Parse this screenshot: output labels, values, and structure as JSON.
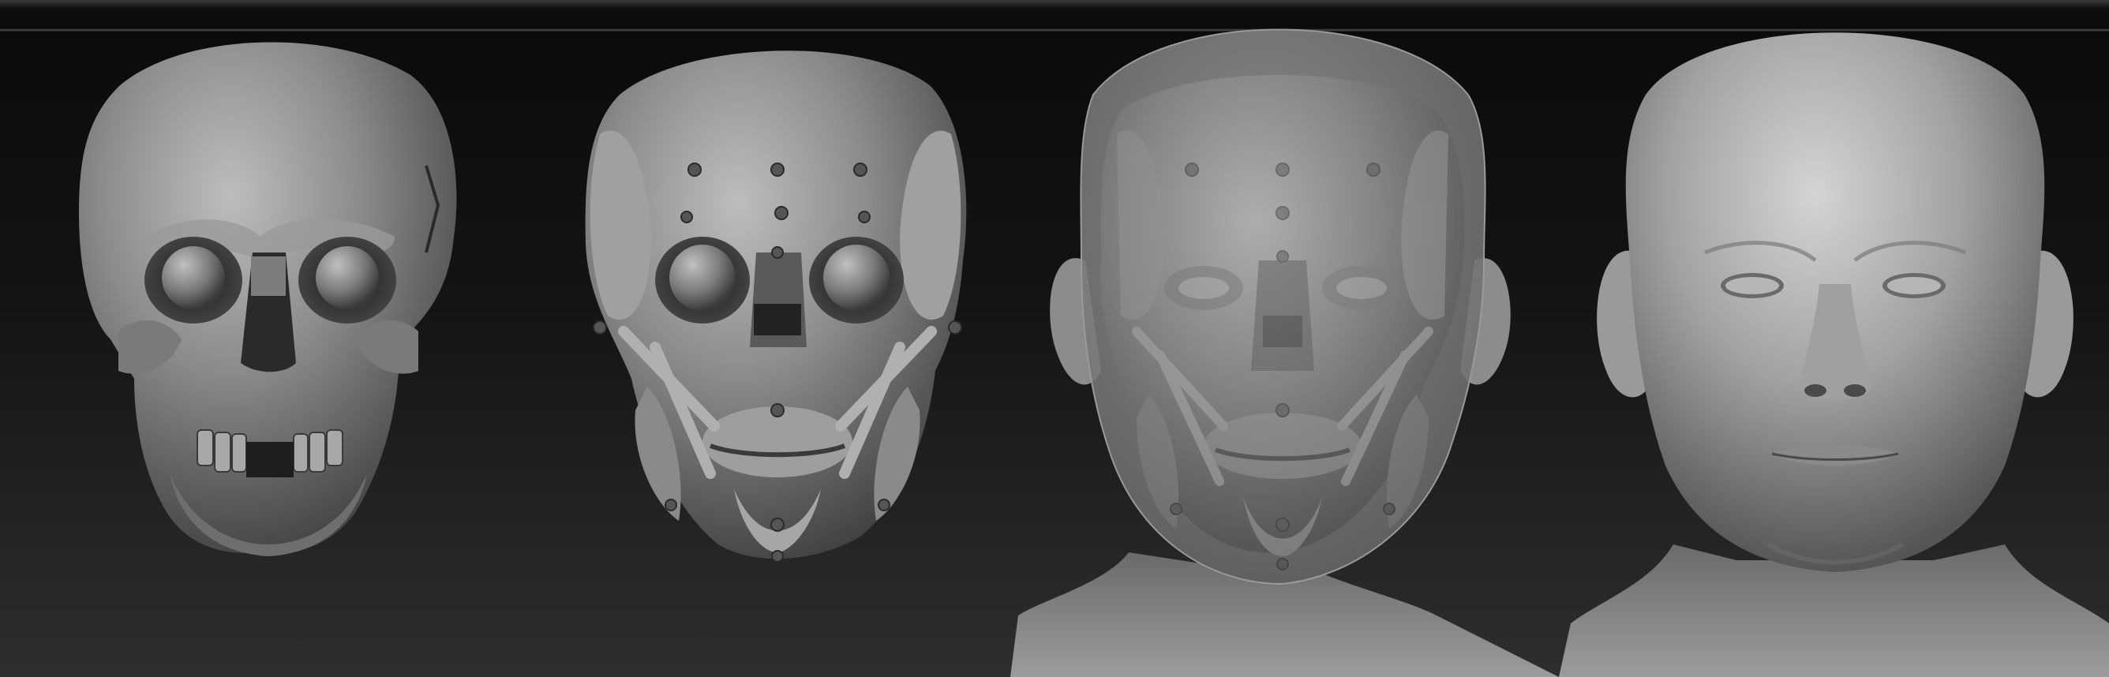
{
  "scene": {
    "stages": [
      {
        "name": "skull"
      },
      {
        "name": "skull-with-muscle-markers"
      },
      {
        "name": "translucent-skin-over-muscles"
      },
      {
        "name": "finished-head"
      }
    ],
    "colors": {
      "background_top": "#0a0a0a",
      "background_bottom": "#2e2e2e",
      "clay": "#8a8a8a",
      "clay_dark": "#4a4a4a",
      "clay_light": "#c8c8c8"
    }
  }
}
